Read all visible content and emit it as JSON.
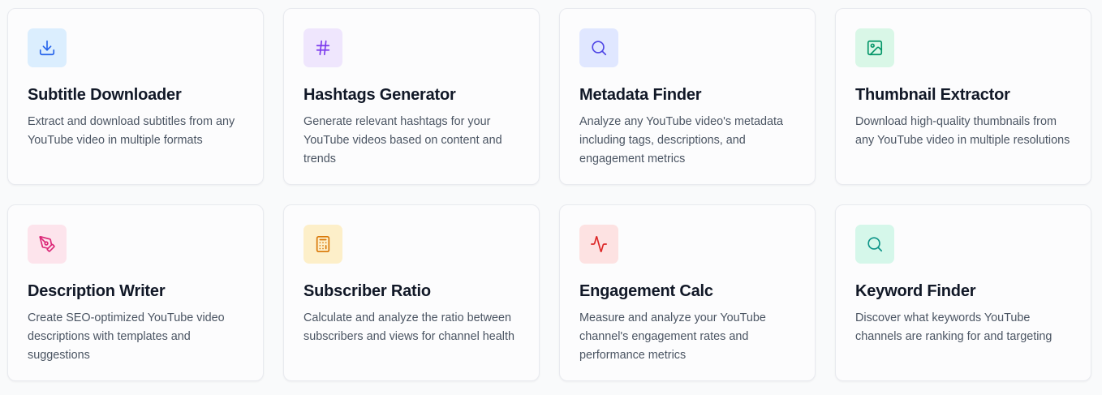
{
  "tools": [
    {
      "title": "Subtitle Downloader",
      "description": "Extract and download subtitles from any YouTube video in multiple formats",
      "icon": "download-icon",
      "icon_bg": "#dbeefe",
      "icon_color": "#2563eb"
    },
    {
      "title": "Hashtags Generator",
      "description": "Generate relevant hashtags for your YouTube videos based on content and trends",
      "icon": "hash-icon",
      "icon_bg": "#efe6fd",
      "icon_color": "#7c3aed"
    },
    {
      "title": "Metadata Finder",
      "description": "Analyze any YouTube video's metadata including tags, descriptions, and engagement metrics",
      "icon": "search-icon",
      "icon_bg": "#e0e7ff",
      "icon_color": "#4f46e5"
    },
    {
      "title": "Thumbnail Extractor",
      "description": "Download high-quality thumbnails from any YouTube video in multiple resolutions",
      "icon": "image-icon",
      "icon_bg": "#d9f7e7",
      "icon_color": "#059669"
    },
    {
      "title": "Description Writer",
      "description": "Create SEO-optimized YouTube video descriptions with templates and suggestions",
      "icon": "pen-tool-icon",
      "icon_bg": "#fde4ec",
      "icon_color": "#db2777"
    },
    {
      "title": "Subscriber Ratio",
      "description": "Calculate and analyze the ratio between subscribers and views for channel health",
      "icon": "calculator-icon",
      "icon_bg": "#fdefc9",
      "icon_color": "#d97706"
    },
    {
      "title": "Engagement Calc",
      "description": "Measure and analyze your YouTube channel's engagement rates and performance metrics",
      "icon": "activity-icon",
      "icon_bg": "#fde2e2",
      "icon_color": "#dc2626"
    },
    {
      "title": "Keyword Finder",
      "description": "Discover what keywords YouTube channels are ranking for and targeting",
      "icon": "search-icon",
      "icon_bg": "#d5f7ea",
      "icon_color": "#0d9488"
    }
  ]
}
